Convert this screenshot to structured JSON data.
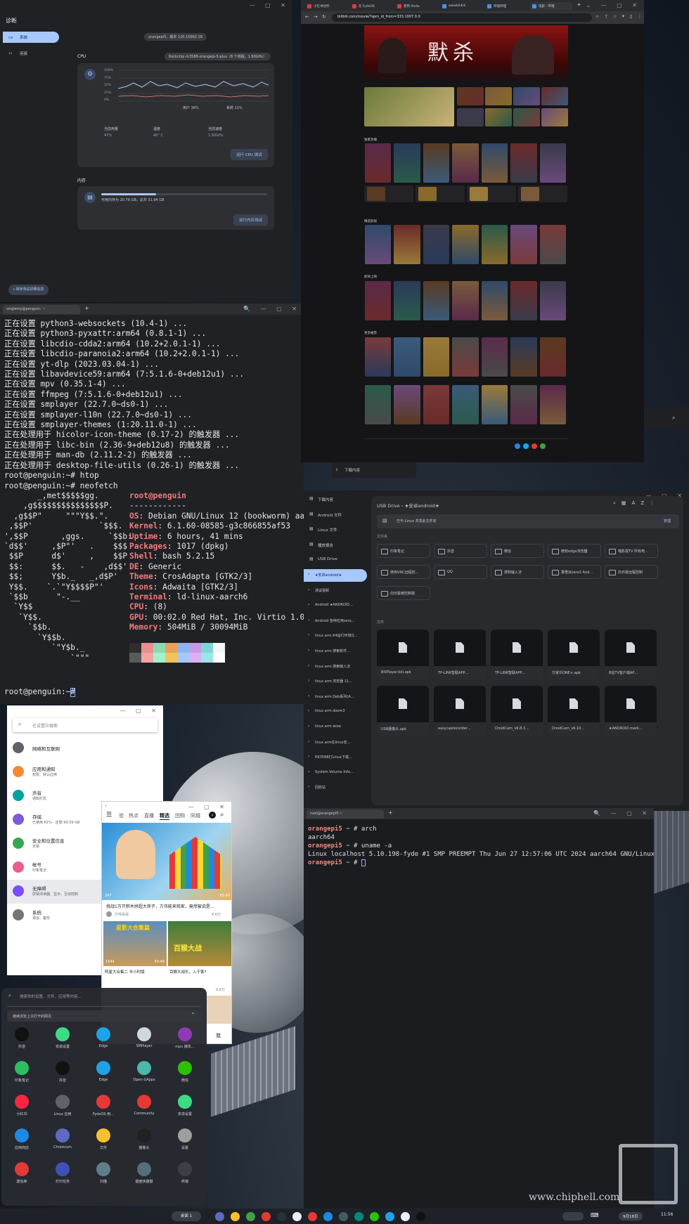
{
  "diagnostics": {
    "title": "诊断",
    "nav": [
      "系统",
      "连接"
    ],
    "version": "orangepi5，版本 120.15662.18",
    "cpu_heading": "CPU",
    "cpu_model": "Rockchip rk3588-orangepi-5-plus（8 个线程，1.80GHz）",
    "y_ticks": [
      "100%",
      "75%",
      "50%",
      "25%",
      "0%"
    ],
    "legend_user": "用户 36%",
    "legend_system": "系统 11%",
    "stats": [
      {
        "label": "当前用量",
        "value": "47%"
      },
      {
        "label": "温度",
        "value": "40° C"
      },
      {
        "label": "当前速度",
        "value": "1.60GHz"
      }
    ],
    "cpu_button": "运行 CPU 测试",
    "memory_heading": "内存",
    "memory_text": "可用内存为 20.76 GB，总共 31.04 GB",
    "memory_used_fraction": 0.33,
    "memory_button": "运行内存测试",
    "save_button": "保存测试详细信息"
  },
  "terminal1": {
    "tab": "singlemy@penguin: ~",
    "add_tab": "+",
    "lines": [
      "正在设置 python3-websockets (10.4-1) ...",
      "正在设置 python3-pyxattr:arm64 (0.8.1-1) ...",
      "正在设置 libcdio-cdda2:arm64 (10.2+2.0.1-1) ...",
      "正在设置 libcdio-paranoia2:arm64 (10.2+2.0.1-1) ...",
      "正在设置 yt-dlp (2023.03.04-1) ...",
      "正在设置 libavdevice59:arm64 (7:5.1.6-0+deb12u1) ...",
      "正在设置 mpv (0.35.1-4) ...",
      "正在设置 ffmpeg (7:5.1.6-0+deb12u1) ...",
      "正在设置 smplayer (22.7.0~ds0-1) ...",
      "正在设置 smplayer-l10n (22.7.0~ds0-1) ...",
      "正在设置 smplayer-themes (1:20.11.0-1) ...",
      "正在处理用于 hicolor-icon-theme (0.17-2) 的触发器 ...",
      "正在处理用于 libc-bin (2.36-9+deb12u8) 的触发器 ...",
      "正在处理用于 man-db (2.11.2-2) 的触发器 ...",
      "正在处理用于 desktop-file-utils (0.26-1) 的触发器 ...",
      "root@penguin:~# htop",
      "root@penguin:~# neofetch"
    ],
    "logo": [
      "       _,met$$$$$gg.",
      "    ,g$$$$$$$$$$$$$$$P.",
      "  ,g$$P\"     \"\"\"Y$$.\".",
      " ,$$P'              `$$$.",
      "',$$P       ,ggs.     `$$b:",
      "`d$$'     ,$P\"'   .    $$$",
      " $$P      d$'     ,    $$P",
      " $$:      $$.   -    ,d$$'",
      " $$;      Y$b._   _,d$P'",
      " Y$$.    `.`\"Y$$$$P\"'",
      " `$$b      \"-.__",
      "  `Y$$",
      "   `Y$$.",
      "     `$$b.",
      "       `Y$$b.",
      "          `\"Y$b._",
      "              `\"\"\""
    ],
    "host": "root@penguin",
    "sep": "------------",
    "info": [
      {
        "k": "OS",
        "v": "Debian GNU/Linux 12 (bookworm) aarch"
      },
      {
        "k": "Kernel",
        "v": "6.1.60-08585-g3c866855af53"
      },
      {
        "k": "Uptime",
        "v": "6 hours, 41 mins"
      },
      {
        "k": "Packages",
        "v": "1017 (dpkg)"
      },
      {
        "k": "Shell",
        "v": "bash 5.2.15"
      },
      {
        "k": "DE",
        "v": "Generic"
      },
      {
        "k": "Theme",
        "v": "CrosAdapta [GTK2/3]"
      },
      {
        "k": "Icons",
        "v": "Adwaita [GTK2/3]"
      },
      {
        "k": "Terminal",
        "v": "ld-linux-aarch6"
      },
      {
        "k": "CPU",
        "v": "(8)"
      },
      {
        "k": "GPU",
        "v": "00:02.0 Red Hat, Inc. Virtio 1.0 GP"
      },
      {
        "k": "Memory",
        "v": "504MiB / 30094MiB"
      }
    ],
    "prompt": "root@penguin:~#"
  },
  "browser": {
    "tabs": [
      "小红书创作",
      "在 FydeOS",
      "使用 Stalw",
      "wwwbilibili",
      "哔哩哔哩",
      "电影 - 哔哩"
    ],
    "url": "bilibili.com/movie/?spm_id_from=333.1007.0.0",
    "hero_title": "默杀",
    "section_titles": [
      "独家热播",
      "精选影视",
      "即将上映",
      "更多推荐"
    ]
  },
  "download_bar": {
    "label": "下载内容"
  },
  "files": {
    "sidebar": [
      "下载内容",
      "Android 文件",
      "Linux 文件",
      "播放报告",
      "USB Drive",
      "★安卓android★",
      "测试视频",
      "Android ★ANDROID…",
      "Android 各种应用zero…",
      "linux arm 64运行环境Q…",
      "linux arm 搜索软件…",
      "linux arm 搜索输入法",
      "linux arm 浏览器 11…",
      "linux arm Deb系列(A…",
      "linux arm doom3",
      "linux arm wine",
      "linux arm在linux安…",
      "RK3588打Linux下载…",
      "System Volume Info…",
      "回收站"
    ],
    "breadcrumb_root": "USB Drive",
    "breadcrumb_current": "★安卓android★",
    "share_banner": "已与 Linux 共享此文件夹",
    "share_manage": "管理",
    "folders_heading": "文件夹",
    "folders": [
      "印象笔记",
      "抖音",
      "微信",
      "微软edge浏览器",
      "喵影视TV 所有电…",
      "使用VNC远程控…",
      "QQ",
      "搜狗输入法",
      "香橙派zero2 And…",
      "向日葵远程控制",
      "向日葵被控制端"
    ],
    "files_heading": "文件",
    "files": [
      "BiliPlayer-bili.apk",
      "TP-LINK智联APP…",
      "TP-LINK智联APP…",
      "万家乐ONE+.apk",
      "B站TV客户端AP…",
      "USB摄像头.apk",
      "easycaprecorder…",
      "DroidCam_v6.8.3…",
      "DroidCam_v6.10…",
      "★ANDROID.mark…"
    ]
  },
  "settings": {
    "search_placeholder": "在设置中搜索",
    "items": [
      {
        "title": "网络和互联网",
        "sub": "",
        "color": "#5f6368"
      },
      {
        "title": "应用和通知",
        "sub": "权限、默认应用",
        "color": "#f28b33"
      },
      {
        "title": "声音",
        "sub": "通知打扰",
        "color": "#00a39b"
      },
      {
        "title": "存储",
        "sub": "已使用 61% - 还剩 99.59 GB",
        "color": "#7b5cd6"
      },
      {
        "title": "安全和位置信息",
        "sub": "无锁",
        "color": "#34a853"
      },
      {
        "title": "帐号",
        "sub": "印象笔记",
        "color": "#ea5f8a"
      },
      {
        "title": "无障碍",
        "sub": "屏幕阅读器、显示、互动控制",
        "color": "#7c4dff"
      },
      {
        "title": "系统",
        "sub": "语言、备份",
        "color": "#757575"
      }
    ]
  },
  "app": {
    "tabs": [
      "验",
      "热点",
      "直播",
      "精选",
      "团购",
      "同城"
    ],
    "active_tab": "精选",
    "video1_caption": "挑战1万只积木拼超大房子，方伟能来我家，竟然被说是…",
    "video1_author": "方伟哥逼",
    "video1_likes": "4.6万",
    "video1_count": "247",
    "video1_time": "05:40",
    "thumb2_text": "星影大合集篇",
    "thumb3_text": "百猴大战",
    "video2_caption": "阿星大合集二 半小时版",
    "video2_count": "1544",
    "video2_time": "40:49",
    "video3_caption": "百猴大战乐，入干客?",
    "video3_likes": "9.6万",
    "me": "我"
  },
  "launcher": {
    "search_placeholder": "搜索你的设置、文件、应用等内容…",
    "recent_label": "继续浏览上次打开的网页",
    "apps": [
      {
        "name": "抖音",
        "color": "#111111"
      },
      {
        "name": "安卓设置",
        "color": "#3ddc84"
      },
      {
        "name": "Edge",
        "color": "#1fa2e8"
      },
      {
        "name": "SMPlayer",
        "color": "#cfd8dc"
      },
      {
        "name": "mpv 媒体…",
        "color": "#8e3ab5"
      },
      {
        "name": "印象笔记",
        "color": "#2dbe60"
      },
      {
        "name": "抖音",
        "color": "#111111"
      },
      {
        "name": "Edge",
        "color": "#1fa2e8"
      },
      {
        "name": "Open GApps",
        "color": "#4db6ac"
      },
      {
        "name": "微信",
        "color": "#2dc100"
      },
      {
        "name": "小红书",
        "color": "#ff2442"
      },
      {
        "name": "Linux 应用",
        "color": "#5f6368"
      },
      {
        "name": "FydeOS 用…",
        "color": "#e53935"
      },
      {
        "name": "Community",
        "color": "#e53935"
      },
      {
        "name": "安卓设置",
        "color": "#3ddc84"
      },
      {
        "name": "应用商店",
        "color": "#1e88e5"
      },
      {
        "name": "Chromium",
        "color": "#5c6bc0"
      },
      {
        "name": "文件",
        "color": "#fbc02d"
      },
      {
        "name": "摄像头",
        "color": "#212121"
      },
      {
        "name": "设置",
        "color": "#9e9e9e"
      },
      {
        "name": "建信库",
        "color": "#e53935"
      },
      {
        "name": "打印任务",
        "color": "#3f51b5"
      },
      {
        "name": "扫描",
        "color": "#607d8b"
      },
      {
        "name": "键盘快捷键",
        "color": "#546e7a"
      },
      {
        "name": "终端",
        "color": "#3c4043"
      }
    ]
  },
  "terminal2": {
    "tab": "root@orangepi5:~",
    "add_tab": "+",
    "lines": [
      {
        "p": "orangepi5",
        "c": " ~ # arch"
      },
      {
        "p": "",
        "c": "aarch64"
      },
      {
        "p": "orangepi5",
        "c": " ~ # uname -a"
      },
      {
        "p": "",
        "c": "Linux localhost 5.10.198-fyde #1 SMP PREEMPT Thu Jun 27 12:57:06 UTC 2024 aarch64 GNU/Linux"
      },
      {
        "p": "orangepi5",
        "c": " ~ # "
      }
    ]
  },
  "shelf": {
    "desk": "桌面 1",
    "date": "9月18日",
    "time": "11:56",
    "watermark": "www.chiphell.com"
  }
}
